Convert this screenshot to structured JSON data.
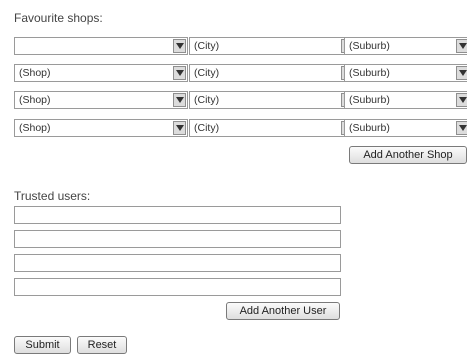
{
  "shops_section": {
    "heading": "Favourite shops:",
    "rows": [
      {
        "shop": "",
        "city": "(City)",
        "suburb": "(Suburb)"
      },
      {
        "shop": "(Shop)",
        "city": "(City)",
        "suburb": "(Suburb)"
      },
      {
        "shop": "(Shop)",
        "city": "(City)",
        "suburb": "(Suburb)"
      },
      {
        "shop": "(Shop)",
        "city": "(City)",
        "suburb": "(Suburb)"
      }
    ],
    "add_button_label": "Add Another Shop"
  },
  "users_section": {
    "heading": "Trusted users:",
    "inputs": [
      "",
      "",
      "",
      ""
    ],
    "add_button_label": "Add Another User"
  },
  "form_actions": {
    "submit_label": "Submit",
    "reset_label": "Reset"
  },
  "icons": {
    "dropdown": "chevron-down-icon"
  }
}
